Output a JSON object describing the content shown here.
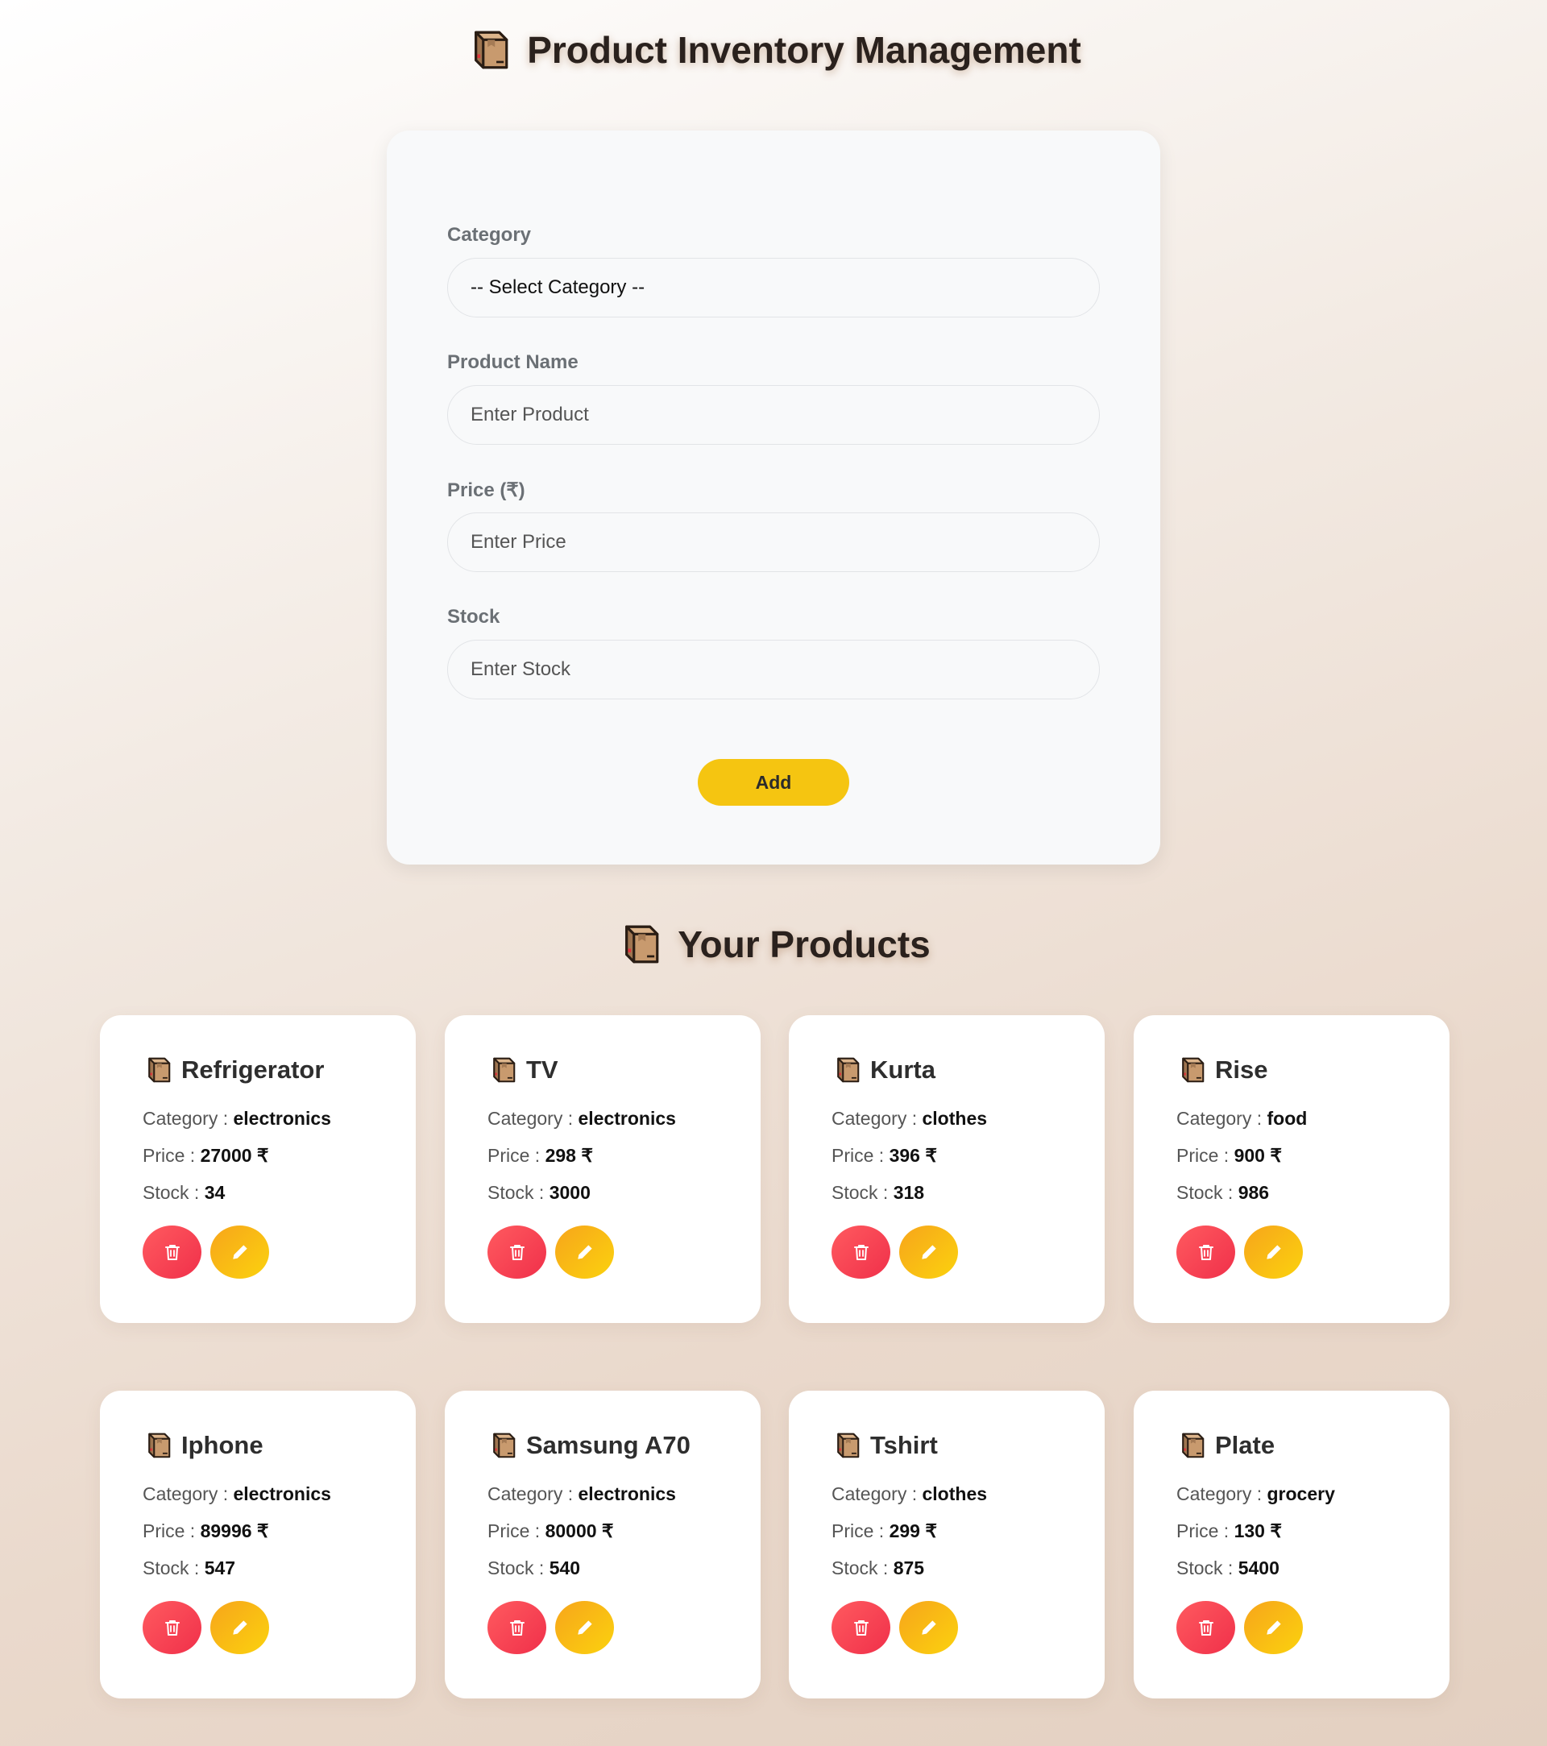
{
  "header": {
    "title": "Product Inventory Management",
    "icon": "package-icon"
  },
  "form": {
    "category_label": "Category",
    "category_value": "-- Select Category --",
    "name_label": "Product Name",
    "name_placeholder": "Enter Product",
    "price_label": "Price (₹)",
    "price_placeholder": "Enter Price",
    "stock_label": "Stock",
    "stock_placeholder": "Enter Stock",
    "add_label": "Add"
  },
  "products_section": {
    "title": "Your Products",
    "icon": "package-icon"
  },
  "card_labels": {
    "category": "Category : ",
    "price": "Price : ",
    "stock": "Stock : ",
    "currency": " ₹"
  },
  "products": [
    {
      "name": "Refrigerator",
      "category": "electronics",
      "price": "27000",
      "stock": "34"
    },
    {
      "name": "TV",
      "category": "electronics",
      "price": "298",
      "stock": "3000"
    },
    {
      "name": "Kurta",
      "category": "clothes",
      "price": "396",
      "stock": "318"
    },
    {
      "name": "Rise",
      "category": "food",
      "price": "900",
      "stock": "986"
    },
    {
      "name": "Iphone",
      "category": "electronics",
      "price": "89996",
      "stock": "547"
    },
    {
      "name": "Samsung A70",
      "category": "electronics",
      "price": "80000",
      "stock": "540"
    },
    {
      "name": "Tshirt",
      "category": "clothes",
      "price": "299",
      "stock": "875"
    },
    {
      "name": "Plate",
      "category": "grocery",
      "price": "130",
      "stock": "5400"
    }
  ],
  "colors": {
    "accent": "#f5c511",
    "delete": "#f0304a",
    "edit": "#f7a51b"
  }
}
